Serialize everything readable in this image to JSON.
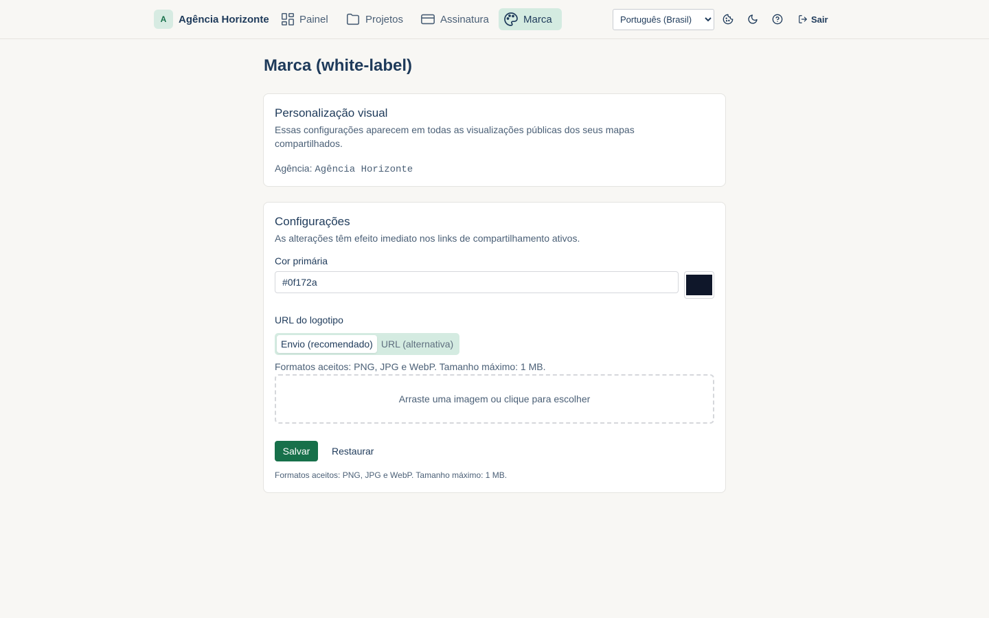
{
  "header": {
    "brand_initial": "A",
    "brand_name": "Agência Horizonte",
    "nav": [
      {
        "label": "Painel",
        "icon": "dashboard-icon"
      },
      {
        "label": "Projetos",
        "icon": "folder-icon"
      },
      {
        "label": "Assinatura",
        "icon": "credit-card-icon"
      },
      {
        "label": "Marca",
        "icon": "palette-icon",
        "active": true
      }
    ],
    "language": "Português (Brasil)",
    "icons": [
      "cookie-icon",
      "moon-icon",
      "help-icon"
    ],
    "logout_label": "Sair"
  },
  "page": {
    "title": "Marca (white-label)"
  },
  "visual_card": {
    "title": "Personalização visual",
    "description": "Essas configurações aparecem em todas as visualizações públicas dos seus mapas compartilhados.",
    "agency_label": "Agência:",
    "agency_value": "Agência Horizonte"
  },
  "settings_card": {
    "title": "Configurações",
    "description": "As alterações têm efeito imediato nos links de compartilhamento ativos.",
    "primary_color_label": "Cor primária",
    "primary_color_value": "#0f172a",
    "logo_label": "URL do logotipo",
    "tabs": [
      {
        "label": "Envio (recomendado)",
        "active": true
      },
      {
        "label": "URL (alternativa)",
        "active": false
      }
    ],
    "formats_hint": "Formatos aceitos: PNG, JPG e WebP. Tamanho máximo: 1 MB.",
    "dropzone_text": "Arraste uma imagem ou clique para escolher",
    "save_label": "Salvar",
    "reset_label": "Restaurar",
    "footer_note": "Formatos aceitos: PNG, JPG e WebP. Tamanho máximo: 1 MB."
  },
  "colors": {
    "accent": "#17704a",
    "accent_soft": "#d4ebe1",
    "text": "#1e3a5a",
    "swatch": "#0f172a"
  }
}
